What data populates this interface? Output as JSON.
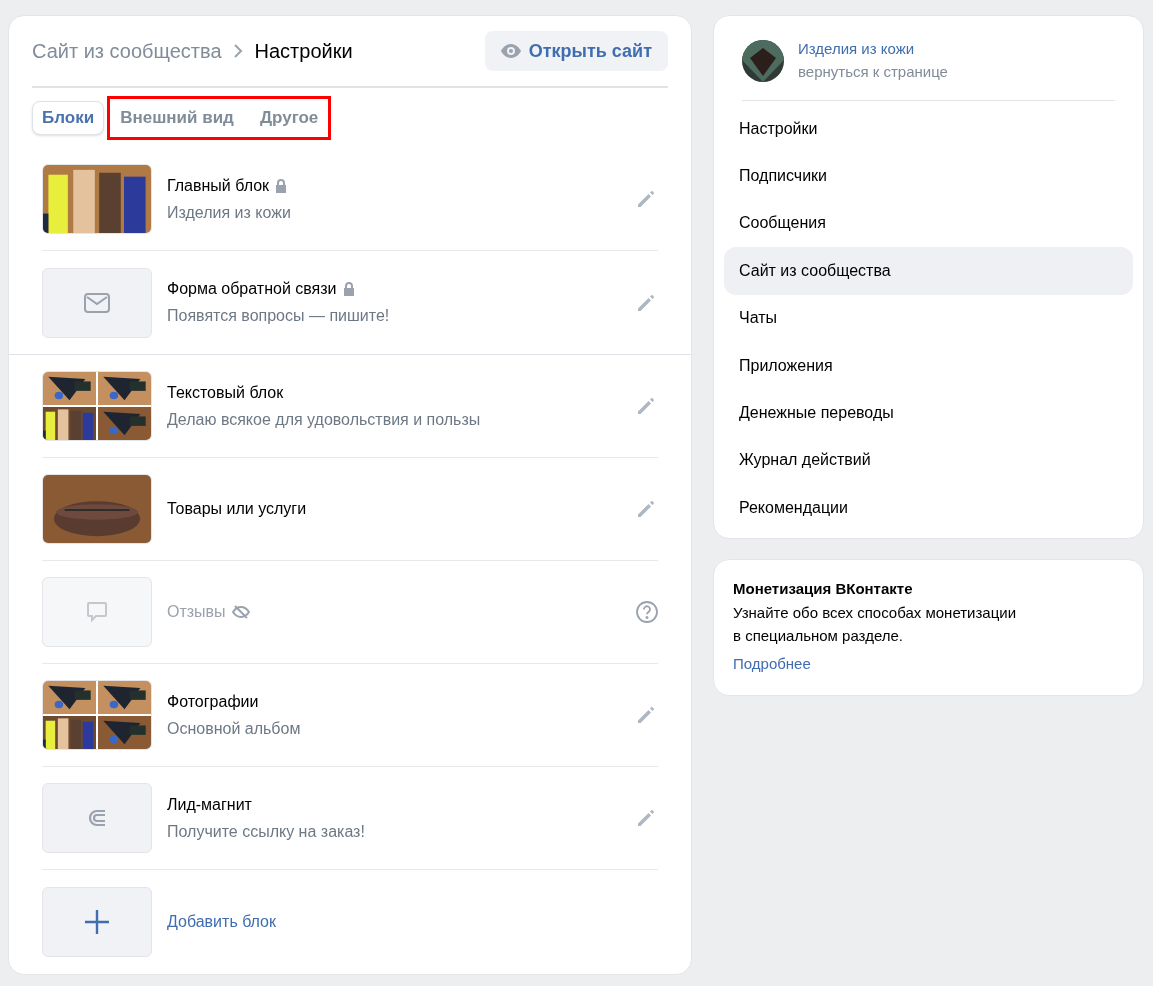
{
  "breadcrumb": {
    "parent": "Сайт из сообщества",
    "current": "Настройки"
  },
  "open_button": "Открыть сайт",
  "tabs": [
    {
      "label": "Блоки",
      "selected": true,
      "highlighted": false
    },
    {
      "label": "Внешний вид",
      "selected": false,
      "highlighted": true
    },
    {
      "label": "Другое",
      "selected": false,
      "highlighted": true
    }
  ],
  "blocks": [
    {
      "title": "Главный блок",
      "subtitle": "Изделия из кожи",
      "locked": true,
      "hidden": false,
      "group_end": false
    },
    {
      "kind": "mail",
      "title": "Форма обратной связи",
      "subtitle": "Появятся вопросы — пишите!",
      "locked": true,
      "hidden": false,
      "group_end": true
    },
    {
      "kind": "collage",
      "title": "Текстовый блок",
      "subtitle": "Делаю всякое для удовольствия и пользы",
      "locked": false,
      "hidden": false,
      "group_end": false
    },
    {
      "title": "Товары или услуги",
      "locked": false,
      "hidden": false,
      "group_end": false
    },
    {
      "kind": "comment",
      "title": "Отзывы",
      "locked": false,
      "hidden": true,
      "group_end": false
    },
    {
      "kind": "collage",
      "title": "Фотографии",
      "subtitle": "Основной альбом",
      "locked": false,
      "hidden": false,
      "group_end": false
    },
    {
      "kind": "magnet",
      "title": "Лид-магнит",
      "subtitle": "Получите ссылку на заказ!",
      "locked": false,
      "hidden": false,
      "group_end": false
    },
    {
      "kind": "add",
      "title": "Добавить блок"
    }
  ],
  "community": {
    "name": "Изделия из кожи",
    "back_link": "вернуться к странице"
  },
  "sidebar": {
    "items": [
      {
        "label": "Настройки",
        "selected": false
      },
      {
        "label": "Подписчики",
        "selected": false
      },
      {
        "label": "Сообщения",
        "selected": false
      },
      {
        "label": "Сайт из сообщества",
        "selected": true
      },
      {
        "label": "Чаты",
        "selected": false
      },
      {
        "label": "Приложения",
        "selected": false
      },
      {
        "label": "Денежные переводы",
        "selected": false
      },
      {
        "label": "Журнал действий",
        "selected": false
      },
      {
        "label": "Рекомендации",
        "selected": false
      }
    ]
  },
  "promo": {
    "title": "Монетизация ВКонтакте",
    "text_lines": [
      "Узнайте обо всех способах монетизации",
      "в специальном разделе."
    ],
    "link": "Подробнее"
  }
}
